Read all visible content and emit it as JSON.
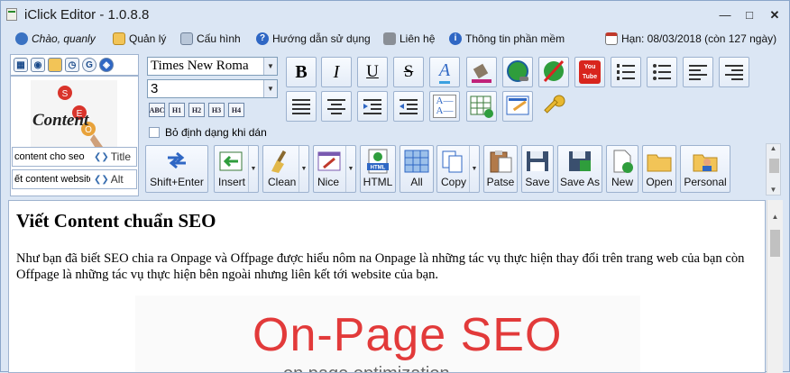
{
  "window": {
    "title": "iClick Editor - 1.0.8.8"
  },
  "menu": [
    {
      "label": "Chào, quanly",
      "icon": "user-icon",
      "italic": true
    },
    {
      "label": "Quản lý",
      "icon": "folder-icon"
    },
    {
      "label": "Cấu hình",
      "icon": "settings-icon"
    },
    {
      "label": "Hướng dẫn sử dụng",
      "icon": "help-icon"
    },
    {
      "label": "Liên hệ",
      "icon": "phone-icon"
    },
    {
      "label": "Thông tin phần mềm",
      "icon": "info-icon"
    },
    {
      "label": "Hạn: 08/03/2018 (còn 127 ngày)",
      "icon": "calendar-icon"
    }
  ],
  "left": {
    "thumb_text": "Content",
    "seo_letters": [
      "S",
      "E",
      "O"
    ],
    "title_field": {
      "value": "content cho seo",
      "label": "Title"
    },
    "alt_field": {
      "value": "ết content website",
      "label": "Alt"
    }
  },
  "format": {
    "font": "Times New Roma",
    "size": "3",
    "headings": [
      "ABC",
      "H1",
      "H2",
      "H3",
      "H4"
    ],
    "checkbox_label": "Bỏ định dạng khi dán"
  },
  "buttons": [
    {
      "label": "Shift+Enter"
    },
    {
      "label": "Insert"
    },
    {
      "label": "Clean"
    },
    {
      "label": "Nice"
    },
    {
      "label": "HTML"
    },
    {
      "label": "All"
    },
    {
      "label": "Copy"
    },
    {
      "label": "Patse"
    },
    {
      "label": "Save"
    },
    {
      "label": "Save As"
    },
    {
      "label": "New"
    },
    {
      "label": "Open"
    },
    {
      "label": "Personal"
    }
  ],
  "doc": {
    "heading": "Viết Content chuẩn SEO",
    "para": "Như bạn đã biết SEO chia ra Onpage và Offpage được hiểu nôm na Onpage là những tác vụ thực hiện thay đổi trên trang web của bạn còn Offpage là những tác vụ thực hiện bên ngoài nhưng liên kết tới website của bạn.",
    "image_big": "On-Page SEO",
    "image_small": "on page optimization"
  },
  "colors": {
    "accent": "#3b6fb6",
    "seo_red": "#e23a3a",
    "window_bg": "#dbe6f4"
  }
}
